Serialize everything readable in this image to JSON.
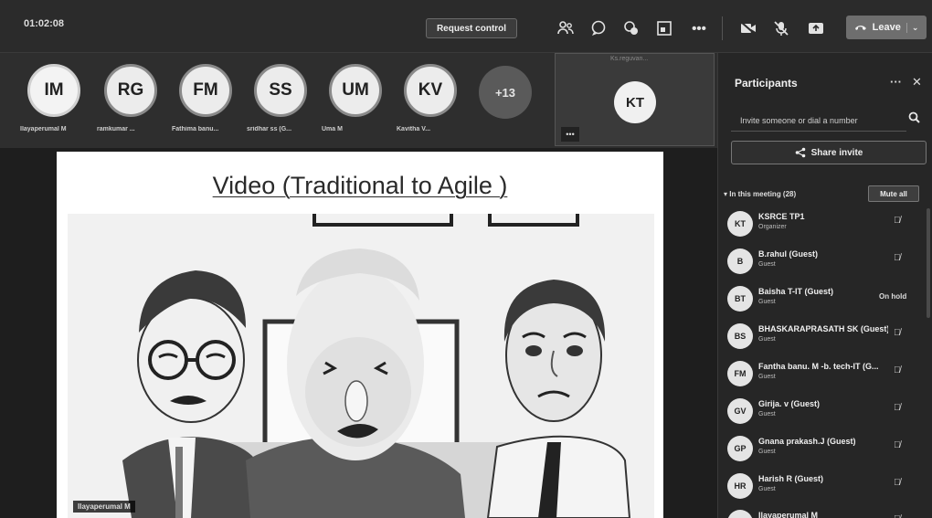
{
  "toolbar": {
    "timer": "01:02:08",
    "request_control": "Request control",
    "leave_label": "Leave",
    "icons": [
      "people-icon",
      "chat-icon",
      "reactions-icon",
      "rooms-icon",
      "more-icon",
      "camera-off-icon",
      "mic-off-icon",
      "share-tray-icon"
    ]
  },
  "strip": {
    "avatars": [
      {
        "initials": "IM",
        "name": "Ilayaperumal M"
      },
      {
        "initials": "RG",
        "name": "ramkumar ..."
      },
      {
        "initials": "FM",
        "name": "Fathima banu..."
      },
      {
        "initials": "SS",
        "name": "sridhar ss (G..."
      },
      {
        "initials": "UM",
        "name": "Uma M"
      },
      {
        "initials": "KV",
        "name": "Kavitha V..."
      }
    ],
    "more_count": "+13",
    "kt_initials": "KT",
    "kt_label": "Ks.reguvan..."
  },
  "slide": {
    "title": "Video (Traditional to Agile )",
    "presenter_label": "Ilayaperumal M"
  },
  "panel": {
    "title": "Participants",
    "invite_placeholder": "Invite someone or dial a number",
    "share_invite": "Share invite",
    "section": "In this meeting (28)",
    "mute_all": "Mute all",
    "participants": [
      {
        "initials": "KT",
        "name": "KSRCE TP1",
        "role": "Organizer",
        "status": "mic-off-icon"
      },
      {
        "initials": "B",
        "name": "B.rahul (Guest)",
        "role": "Guest",
        "status": "mic-off-icon"
      },
      {
        "initials": "BT",
        "name": "Baisha T-IT (Guest)",
        "role": "Guest",
        "status_text": "On hold"
      },
      {
        "initials": "BS",
        "name": "BHASKARAPRASATH SK (Guest)",
        "role": "Guest",
        "status": "mic-off-icon"
      },
      {
        "initials": "FM",
        "name": "Fantha banu. M -b. tech-IT (G...",
        "role": "Guest",
        "status": "mic-off-icon"
      },
      {
        "initials": "GV",
        "name": "Girija. v (Guest)",
        "role": "Guest",
        "status": "mic-off-icon"
      },
      {
        "initials": "GP",
        "name": "Gnana prakash.J (Guest)",
        "role": "Guest",
        "status": "mic-off-icon"
      },
      {
        "initials": "HR",
        "name": "Harish R (Guest)",
        "role": "Guest",
        "status": "mic-off-icon"
      },
      {
        "initials": "IM",
        "name": "Ilayaperumal M",
        "role": "",
        "status": "mic-off-icon"
      }
    ]
  },
  "colors": {
    "toolbar_bg": "#2b2b2b",
    "panel_bg": "#262626",
    "slide_bg": "#ffffff"
  }
}
